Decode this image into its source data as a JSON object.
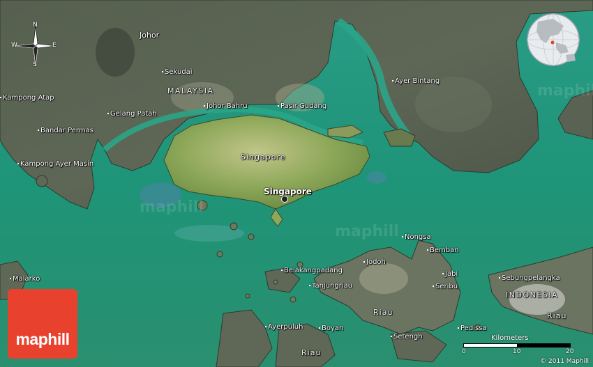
{
  "map": {
    "labels": {
      "johor": "Johor",
      "malaysia": "MALAYSIA",
      "sekudai": "Sekudai",
      "kampong_atap": "Kampong Atap",
      "gelang_patah": "Gelang Patah",
      "johor_bahru": "Johor Bahru",
      "pasir_gudang": "Pasir Gudang",
      "ayer_bintang": "Ayer Bintang",
      "bandar_permas": "Bandar Permas",
      "kampong_ayer_masin": "Kampong Ayer Masin",
      "singapore_island": "Singapore",
      "singapore_city": "Singapore",
      "nongsa": "Nongsa",
      "bemban": "Bemban",
      "jodoh": "Jodoh",
      "jabi": "Jabi",
      "belakangpadang": "Belakangpadang",
      "seribu": "Seribu",
      "sebungpelangka": "Sebungpelangka",
      "malarko": "Malarko",
      "tanjungriau": "Tanjungriau",
      "riau_1": "Riau",
      "indonesia": "INDONESIA",
      "riau_2": "Riau",
      "ayerpuluh": "Ayerpuluh",
      "boyan": "Boyan",
      "pedissa": "Pedissa",
      "setengh": "Setengh",
      "riau_3": "Riau"
    },
    "compass": {
      "n": "N",
      "s": "S",
      "e": "E",
      "w": "W"
    },
    "watermark": "maphill",
    "colors": {
      "water": "#1f9a7e",
      "land": "#4f5a4a",
      "singapore": "#8aa653",
      "brand": "#e8412e"
    }
  },
  "logo": {
    "text": "maphill"
  },
  "scale": {
    "label": "Kilometers",
    "ticks": [
      "0",
      "10",
      "20"
    ]
  },
  "copyright": "© 2011 Maphill"
}
